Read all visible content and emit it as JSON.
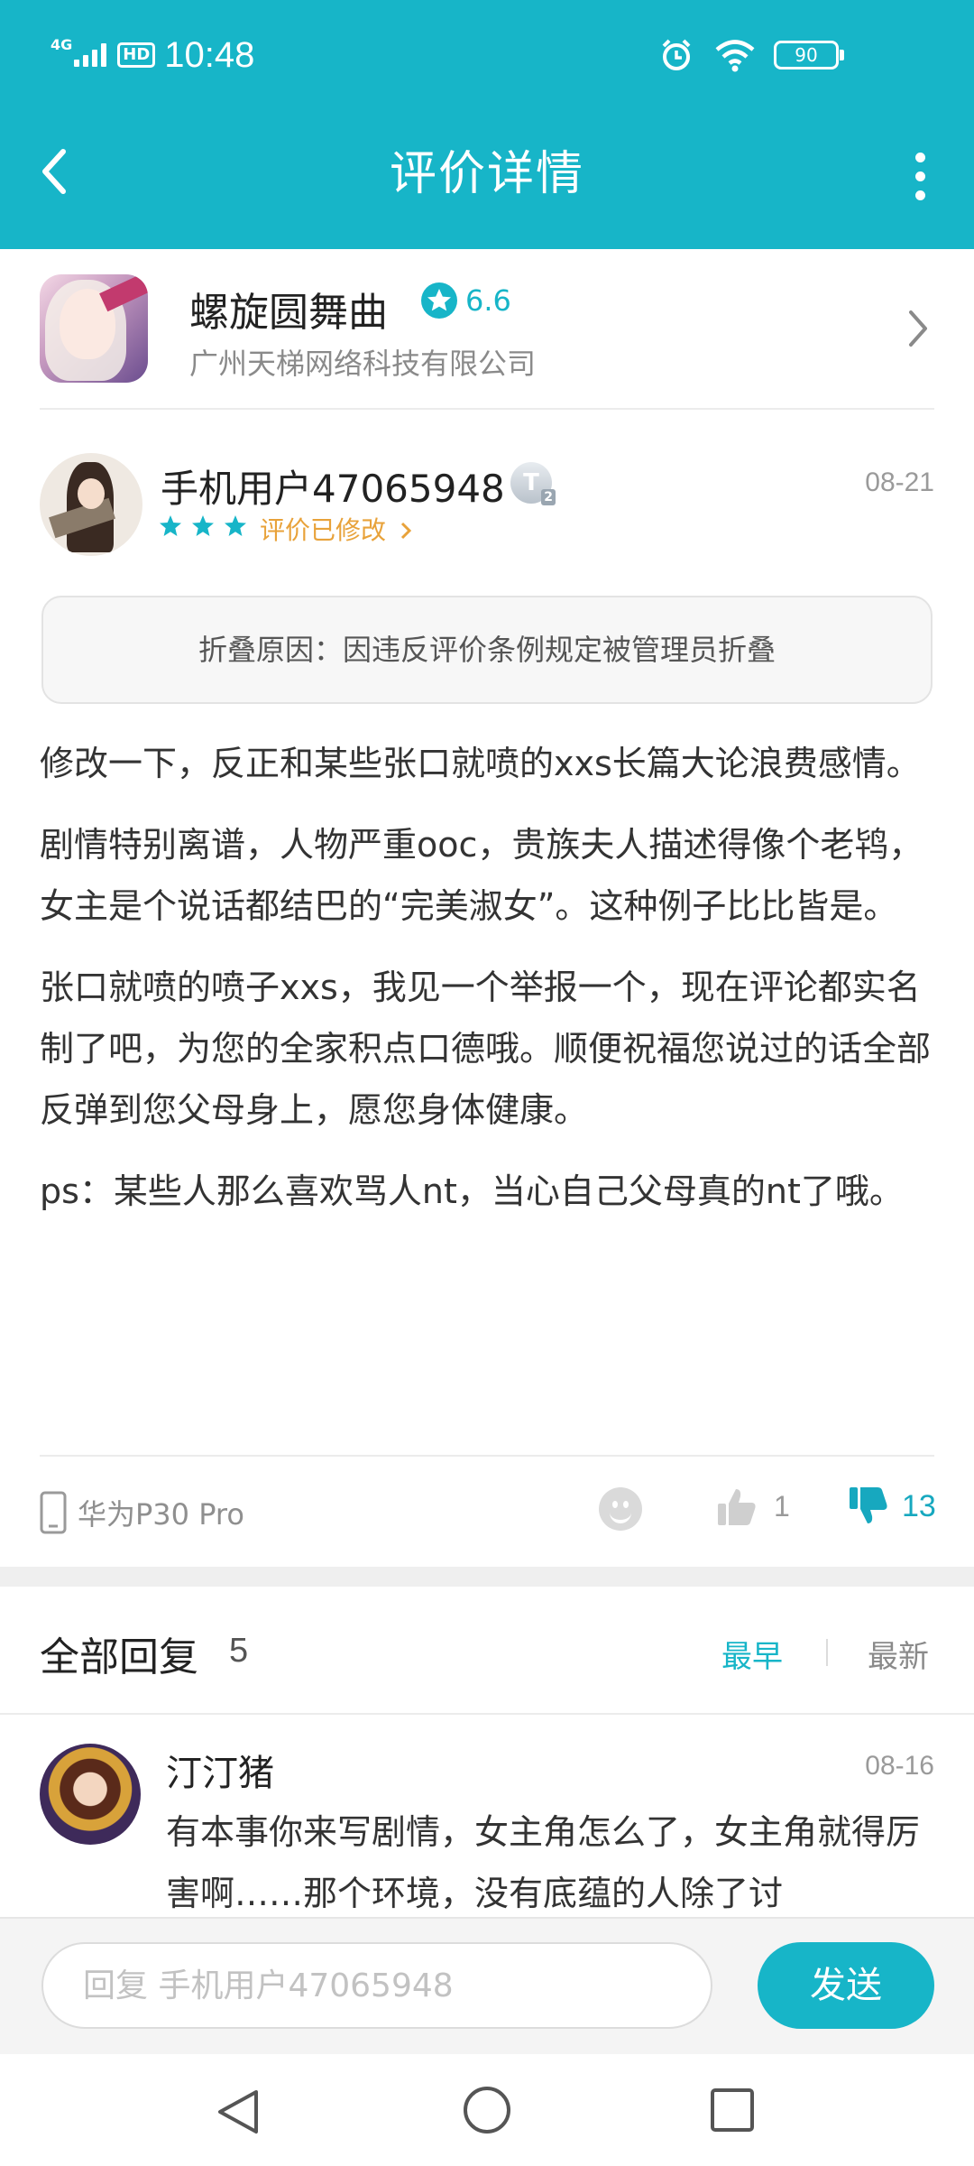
{
  "status_bar": {
    "network": "4G",
    "hd": "HD",
    "time": "10:48",
    "battery": "90"
  },
  "header": {
    "title": "评价详情",
    "accent": "#17b5c8"
  },
  "app": {
    "name": "螺旋圆舞曲",
    "rating": "6.6",
    "developer": "广州天梯网络科技有限公司"
  },
  "review": {
    "username": "手机用户47065948",
    "level_badge": "T",
    "level_sub": "2",
    "date": "08-21",
    "stars": 3,
    "modified_label": "评价已修改",
    "fold_reason": "折叠原因：因违反评价条例规定被管理员折叠",
    "paragraphs": [
      "修改一下，反正和某些张口就喷的xxs长篇大论浪费感情。",
      "剧情特别离谱，人物严重ooc，贵族夫人描述得像个老鸨，女主是个说话都结巴的“完美淑女”。这种例子比比皆是。",
      "张口就喷的喷子xxs，我见一个举报一个，现在评论都实名制了吧，为您的全家积点口德哦。顺便祝福您说过的话全部反弹到您父母身上，愿您身体健康。",
      "ps：某些人那么喜欢骂人nt，当心自己父母真的nt了哦。"
    ],
    "device": "华为P30 Pro",
    "likes": "1",
    "dislikes": "13"
  },
  "replies": {
    "title": "全部回复",
    "count": "5",
    "sort_earliest": "最早",
    "sort_latest": "最新",
    "items": [
      {
        "name": "汀汀猪",
        "date": "08-16",
        "text": "有本事你来写剧情，女主角怎么了，女主角就得厉害啊……那个环境，没有底蕴的人除了讨"
      }
    ]
  },
  "reply_bar": {
    "placeholder": "回复 手机用户47065948",
    "send_label": "发送"
  }
}
